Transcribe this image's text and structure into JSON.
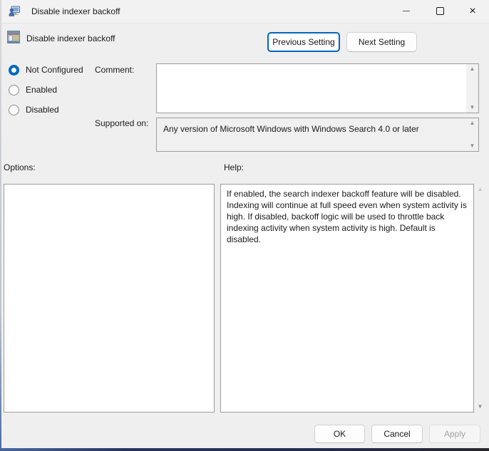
{
  "window": {
    "title": "Disable indexer backoff"
  },
  "icons": {
    "close": "×",
    "scroll_up": "▲",
    "scroll_down": "▼"
  },
  "header": {
    "policy_name": "Disable indexer backoff",
    "previous_label": "Previous Setting",
    "next_label": "Next Setting"
  },
  "radios": {
    "items": [
      {
        "label": "Not Configured",
        "selected": true
      },
      {
        "label": "Enabled",
        "selected": false
      },
      {
        "label": "Disabled",
        "selected": false
      }
    ]
  },
  "fields": {
    "comment": {
      "label": "Comment:",
      "value": ""
    },
    "supported": {
      "label": "Supported on:",
      "value": "Any version of Microsoft Windows with Windows Search 4.0 or later"
    }
  },
  "panels": {
    "options_label": "Options:",
    "help_label": "Help:",
    "help_text": "If enabled, the search indexer backoff feature will be disabled. Indexing will continue at full speed even when system activity is high. If disabled, backoff logic will be used to throttle back indexing activity when system activity is high. Default is disabled."
  },
  "footer": {
    "ok_label": "OK",
    "cancel_label": "Cancel",
    "apply_label": "Apply"
  },
  "colors": {
    "accent": "#0067c0",
    "window_bg": "#efefef",
    "box_border": "#9d9d9d",
    "disabled_text": "#a3a3a3",
    "bottom_edge": "#29335f"
  }
}
